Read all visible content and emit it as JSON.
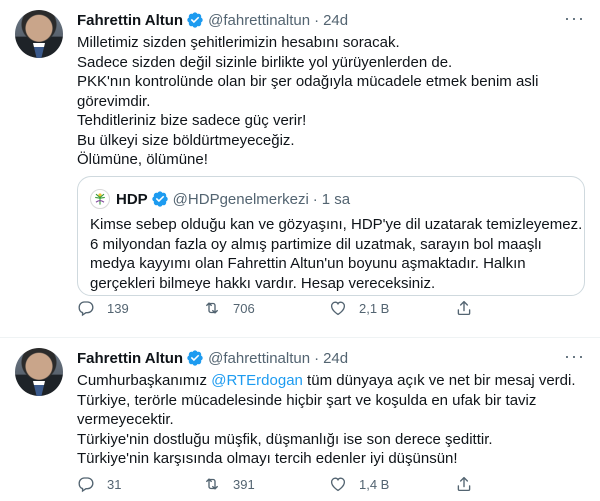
{
  "tweets": [
    {
      "name": "Fahrettin Altun",
      "handle": "@fahrettinaltun",
      "dot": "·",
      "time": "24d",
      "text_lines": [
        "Milletimiz sizden şehitlerimizin hesabını soracak.",
        "Sadece sizden değil sizinle birlikte yol yürüyenlerden de.",
        "PKK'nın kontrolünde olan bir şer odağıyla mücadele etmek benim asli",
        "görevimdir.",
        "Tehditleriniz bize sadece güç verir!",
        "Bu ülkeyi size böldürtmeyeceğiz.",
        "Ölümüne, ölümüne!"
      ],
      "quote": {
        "name": "HDP",
        "handle": "@HDPgenelmerkezi",
        "dot": "·",
        "time": "1 sa",
        "text_lines": [
          "Kimse sebep olduğu kan ve gözyaşını, HDP'ye dil uzatarak temizleyemez.",
          "6 milyondan fazla oy almış partimize dil uzatmak, sarayın bol maaşlı",
          "medya kayyımı olan Fahrettin Altun'un boyunu aşmaktadır. Halkın",
          "gerçekleri bilmeye hakkı vardır. Hesap vereceksiniz."
        ]
      },
      "replies": "139",
      "retweets": "706",
      "likes": "2,1 B"
    },
    {
      "name": "Fahrettin Altun",
      "handle": "@fahrettinaltun",
      "dot": "·",
      "time": "24d",
      "line1_pre": "Cumhurbaşkanımız ",
      "line1_mention": "@RTErdogan",
      "line1_post": " tüm dünyaya açık ve net bir mesaj verdi.",
      "text_lines": [
        "Türkiye, terörle mücadelesinde hiçbir şart ve koşulda en ufak bir taviz",
        "vermeyecektir.",
        "Türkiye'nin dostluğu müşfik, düşmanlığı ise son derece şedittir.",
        "Türkiye'nin karşısında olmayı tercih edenler iyi düşünsün!"
      ],
      "replies": "31",
      "retweets": "391",
      "likes": "1,4 B"
    }
  ],
  "colors": {
    "accent": "#1d9bf0",
    "muted": "#536471",
    "hdp_green": "#3a9d3a"
  },
  "icons": [
    "verified-badge-icon",
    "more-icon",
    "reply-icon",
    "retweet-icon",
    "like-icon",
    "share-icon",
    "hdp-logo-icon"
  ]
}
